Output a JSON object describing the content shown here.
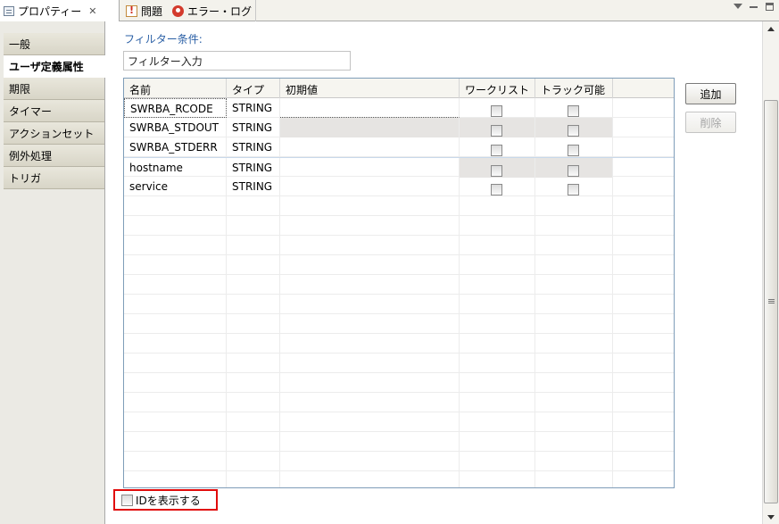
{
  "view_tabs": [
    {
      "label": "プロパティー",
      "icon": "properties-icon",
      "closable": true
    },
    {
      "label": "問題",
      "icon": "problems-icon"
    },
    {
      "label": "エラー・ログ",
      "icon": "error-log-icon"
    }
  ],
  "view_controls": [
    "view-menu-icon",
    "minimize-icon",
    "maximize-icon"
  ],
  "nav": {
    "items": [
      "一般",
      "ユーザ定義属性",
      "期限",
      "タイマー",
      "アクションセット",
      "例外処理",
      "トリガ"
    ],
    "selected_index": 1
  },
  "filter": {
    "label": "フィルター条件:",
    "value": "フィルター入力"
  },
  "table": {
    "columns": [
      "名前",
      "タイプ",
      "初期値",
      "ワークリスト",
      "トラック可能"
    ],
    "rows": [
      {
        "name": "SWRBA_RCODE",
        "type": "STRING",
        "initial": "",
        "worklist": false,
        "trackable": false
      },
      {
        "name": "SWRBA_STDOUT",
        "type": "STRING",
        "initial": "",
        "worklist": false,
        "trackable": false
      },
      {
        "name": "SWRBA_STDERR",
        "type": "STRING",
        "initial": "",
        "worklist": false,
        "trackable": false
      },
      {
        "name": "hostname",
        "type": "STRING",
        "initial": "",
        "worklist": false,
        "trackable": false
      },
      {
        "name": "service",
        "type": "STRING",
        "initial": "",
        "worklist": false,
        "trackable": false
      }
    ]
  },
  "buttons": {
    "add": "追加",
    "delete": "削除"
  },
  "show_id": {
    "label": "IDを表示する",
    "checked": false
  },
  "colors": {
    "highlight_border": "#e10b0b",
    "filter_label": "#2a5fa5",
    "shaded_cell": "#e6e4e2"
  }
}
